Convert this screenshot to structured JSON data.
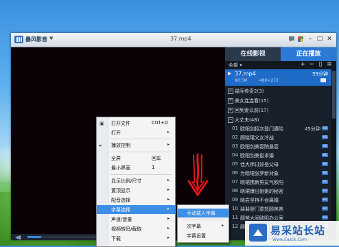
{
  "window": {
    "app_name": "暴风影音",
    "file_title": "37.mp4",
    "menu_caret": "▼"
  },
  "panel": {
    "tabs": [
      "在线影视",
      "正在播放"
    ],
    "filter_label": "全部 ▾",
    "toolbar_icons": [
      "add-icon",
      "remove-icon",
      "clear-icon",
      "list-icon"
    ],
    "now_playing": {
      "title": "37.mp4",
      "duration": "59分钟",
      "size": "90.5M",
      "resolution": "480×272"
    },
    "groups": [
      {
        "label": "星际传奇2(3)",
        "expanded": false
      },
      {
        "label": "美女连连看(15)",
        "expanded": false
      },
      {
        "label": "回到爱以前(17)",
        "expanded": false
      },
      {
        "label": "大丈夫(48)",
        "expanded": true
      }
    ],
    "items": [
      {
        "num": "01",
        "name": "欧阳剑招次登门遇险",
        "duration": "45分钟",
        "badge": "HD"
      },
      {
        "num": "02",
        "name": "顾晓珺父女冷战",
        "duration": "",
        "badge": "HD"
      },
      {
        "num": "03",
        "name": "欧阳剑美容院悬容",
        "duration": "",
        "badge": "HD"
      },
      {
        "num": "04",
        "name": "欧阳剑美俊求婚",
        "duration": "",
        "badge": "HD"
      },
      {
        "num": "05",
        "name": "佳大师讨好岳父母",
        "duration": "",
        "badge": "HD"
      },
      {
        "num": "06",
        "name": "为晓珺张罗新对象",
        "duration": "",
        "badge": "HD"
      },
      {
        "num": "07",
        "name": "晓珺携新男友气欧阳",
        "duration": "",
        "badge": "HD"
      },
      {
        "num": "08",
        "name": "晓珺爆出姐姐的秘密",
        "duration": "",
        "badge": "HD"
      },
      {
        "num": "09",
        "name": "晓岩坚持不会离婚",
        "duration": "",
        "badge": "HD"
      },
      {
        "num": "10",
        "name": "裴裴登门意怒顾爸爸",
        "duration": "",
        "badge": "HD"
      },
      {
        "num": "11",
        "name": "顾爸大闹欧阳办公室",
        "duration": "",
        "badge": "HD"
      },
      {
        "num": "12",
        "name": "顾欧未果",
        "duration": "",
        "badge": "HD"
      }
    ]
  },
  "context_menu": {
    "items": [
      {
        "label": "打开文件",
        "shortcut": "Ctrl+O",
        "arrow": "",
        "icon": "▣",
        "highlighted": false
      },
      {
        "label": "打开",
        "shortcut": "",
        "arrow": "▸",
        "icon": "",
        "highlighted": false
      },
      {
        "label": "播放控制",
        "shortcut": "",
        "arrow": "▸",
        "icon": "▸",
        "highlighted": false
      },
      {
        "label": "全屏",
        "shortcut": "回车",
        "arrow": "",
        "icon": "",
        "highlighted": false
      },
      {
        "label": "最小界面",
        "shortcut": "1",
        "arrow": "",
        "icon": "",
        "highlighted": false
      },
      {
        "label": "显示比例/尺寸",
        "shortcut": "",
        "arrow": "▸",
        "icon": "",
        "highlighted": false
      },
      {
        "label": "置顶显示",
        "shortcut": "",
        "arrow": "▸",
        "icon": "",
        "highlighted": false
      },
      {
        "label": "配音选择",
        "shortcut": "",
        "arrow": "▸",
        "icon": "",
        "highlighted": false
      },
      {
        "label": "字幕选择",
        "shortcut": "",
        "arrow": "▸",
        "icon": "",
        "highlighted": true
      },
      {
        "label": "声道/音量",
        "shortcut": "",
        "arrow": "▸",
        "icon": "",
        "highlighted": false
      },
      {
        "label": "视频转码/截取",
        "shortcut": "",
        "arrow": "▸",
        "icon": "",
        "highlighted": false
      },
      {
        "label": "下载",
        "shortcut": "",
        "arrow": "▸",
        "icon": "",
        "highlighted": false
      }
    ]
  },
  "submenu": {
    "items": [
      {
        "label": "手动载入字幕",
        "arrow": "",
        "highlighted": true
      },
      {
        "label": "次字幕",
        "arrow": "▸",
        "highlighted": false
      },
      {
        "label": "字幕设置",
        "arrow": "",
        "highlighted": false
      }
    ]
  },
  "watermark": {
    "text": "易采站长站",
    "url": "Www.Easck.Com"
  },
  "colors": {
    "accent": "#2c7ad6",
    "highlight": "#3d8ee6",
    "arrow": "#e0161c",
    "panel_bg": "#17202b"
  }
}
